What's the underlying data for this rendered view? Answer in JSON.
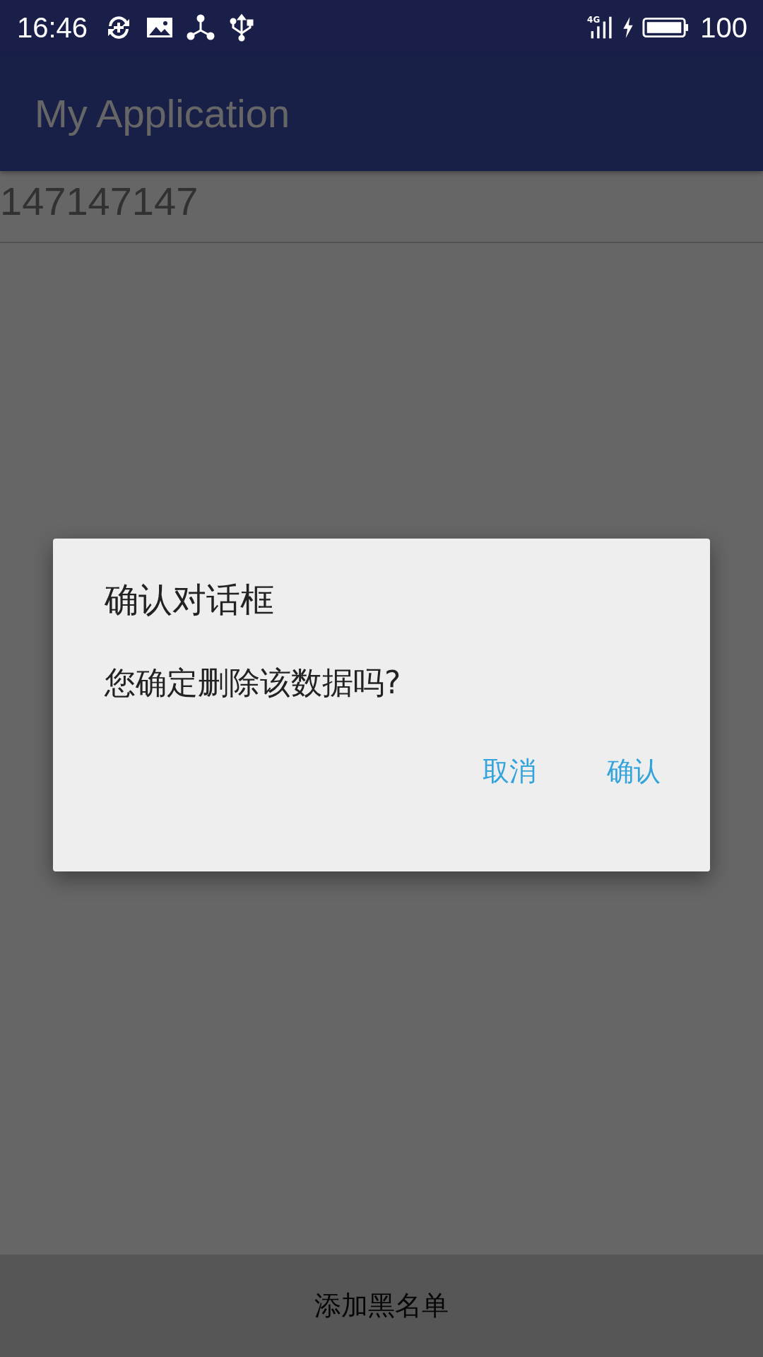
{
  "status_bar": {
    "time": "16:46",
    "network": "4G",
    "battery": "100"
  },
  "app_bar": {
    "title": "My Application"
  },
  "list": {
    "items": [
      {
        "text": "147147147"
      }
    ]
  },
  "bottom_button": {
    "label": "添加黑名单"
  },
  "dialog": {
    "title": "确认对话框",
    "message": "您确定删除该数据吗?",
    "buttons": [
      {
        "label": "取消",
        "kind": "negative"
      },
      {
        "label": "确认",
        "kind": "positive"
      }
    ]
  }
}
